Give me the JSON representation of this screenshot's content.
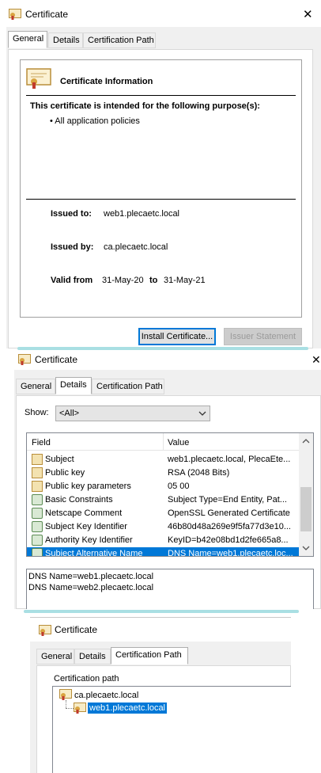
{
  "dialog1": {
    "title": "Certificate",
    "close_glyph": "✕",
    "tabs": [
      "General",
      "Details",
      "Certification Path"
    ],
    "info_heading": "Certificate Information",
    "purpose_heading": "This certificate is intended for the following purpose(s):",
    "purpose_items": [
      "• All application policies"
    ],
    "issued_to_label": "Issued to:",
    "issued_to_value": "web1.plecaetc.local",
    "issued_by_label": "Issued by:",
    "issued_by_value": "ca.plecaetc.local",
    "valid_from_label": "Valid from",
    "valid_from_value": "31-May-20",
    "valid_to_label": "to",
    "valid_to_value": "31-May-21",
    "install_button": "Install Certificate...",
    "issuer_button": "Issuer Statement"
  },
  "dialog2": {
    "title": "Certificate",
    "close_glyph": "✕",
    "tabs": [
      "General",
      "Details",
      "Certification Path"
    ],
    "show_label": "Show:",
    "show_value": "<All>",
    "col_field": "Field",
    "col_value": "Value",
    "rows": [
      {
        "field": "Subject",
        "value": "web1.plecaetc.local, PlecaEte...",
        "icon": "cert-field-icon"
      },
      {
        "field": "Public key",
        "value": "RSA (2048 Bits)",
        "icon": "cert-field-icon"
      },
      {
        "field": "Public key parameters",
        "value": "05 00",
        "icon": "cert-field-icon"
      },
      {
        "field": "Basic Constraints",
        "value": "Subject Type=End Entity, Pat...",
        "icon": "extension-icon"
      },
      {
        "field": "Netscape Comment",
        "value": "OpenSSL Generated Certificate",
        "icon": "extension-icon"
      },
      {
        "field": "Subject Key Identifier",
        "value": "46b80d48a269e9f5fa77d3e10...",
        "icon": "extension-icon"
      },
      {
        "field": "Authority Key Identifier",
        "value": "KeyID=b42e08bd1d2fe665a8...",
        "icon": "extension-icon"
      },
      {
        "field": "Subject Alternative Name",
        "value": "DNS Name=web1.plecaetc.loc...",
        "icon": "extension-icon"
      }
    ],
    "detail_lines": [
      "DNS Name=web1.plecaetc.local",
      "DNS Name=web2.plecaetc.local"
    ]
  },
  "dialog3": {
    "title": "Certificate",
    "tabs": [
      "General",
      "Details",
      "Certification Path"
    ],
    "path_label": "Certification path",
    "root_node": "ca.plecaetc.local",
    "child_node": "web1.plecaetc.local"
  },
  "colors": {
    "accent": "#0078d7",
    "divider": "#a9dfe3"
  }
}
